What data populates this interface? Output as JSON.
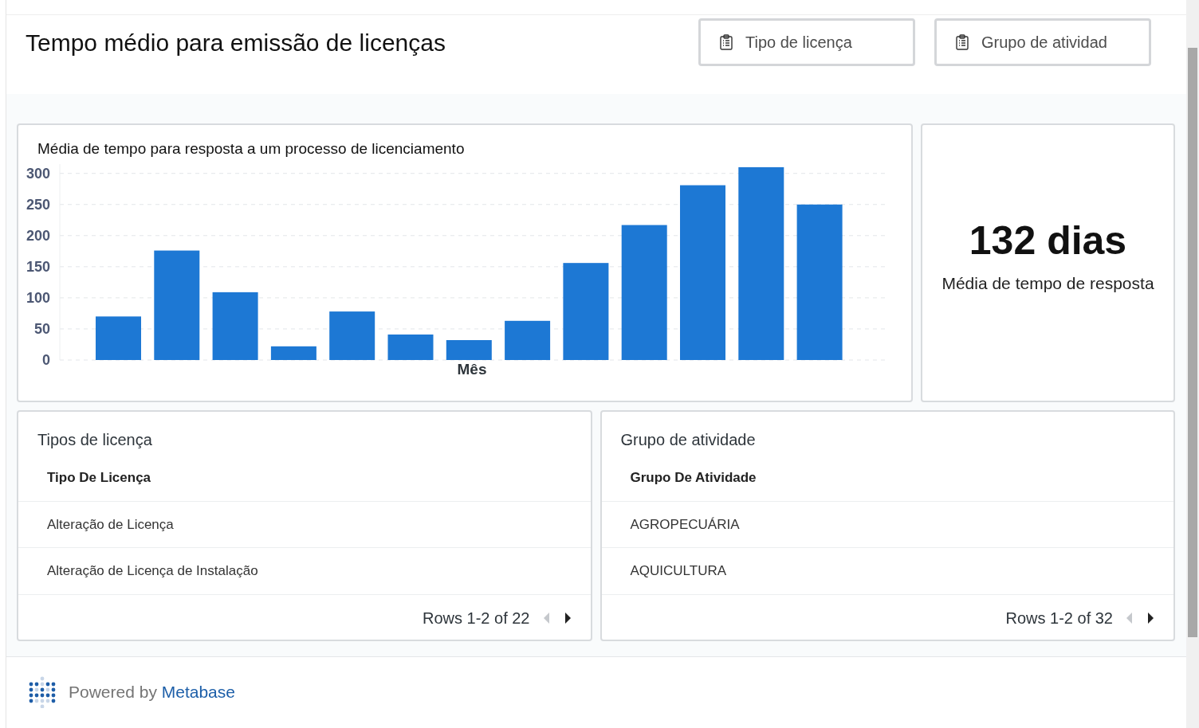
{
  "header": {
    "title": "Tempo médio para emissão de licenças",
    "filters": [
      {
        "label": "Tipo de licença"
      },
      {
        "label": "Grupo de atividad"
      }
    ]
  },
  "chart_card": {
    "title": "Média de tempo para resposta a um processo de licenciamento",
    "chart_data": {
      "type": "bar",
      "xlabel": "Mês",
      "ylim": [
        0,
        315
      ],
      "yticks": [
        0,
        50,
        100,
        150,
        200,
        250,
        300
      ],
      "grid": true,
      "series": [
        {
          "color": "#1d78d4",
          "values": [
            70,
            176,
            109,
            22,
            78,
            41,
            32,
            63,
            156,
            217,
            281,
            310,
            250
          ]
        }
      ]
    }
  },
  "scalar_card": {
    "value": "132 dias",
    "label": "Média de tempo de resposta"
  },
  "tables": [
    {
      "title": "Tipos de licença",
      "column": "Tipo De Licença",
      "rows": [
        "Alteração de Licença",
        "Alteração de Licença de Instalação"
      ],
      "pagination": "Rows 1-2 of 22"
    },
    {
      "title": "Grupo de atividade",
      "column": "Grupo De Atividade",
      "rows": [
        "AGROPECUÁRIA",
        "AQUICULTURA"
      ],
      "pagination": "Rows 1-2 of 32"
    }
  ],
  "footer": {
    "powered_by": "Powered by",
    "brand": "Metabase"
  }
}
